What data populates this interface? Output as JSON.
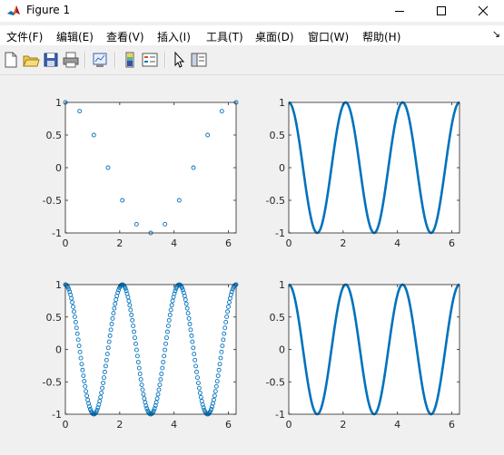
{
  "window": {
    "title": "Figure 1",
    "controls": [
      "minimize",
      "maximize",
      "close"
    ]
  },
  "menu": {
    "items": [
      "文件(F)",
      "编辑(E)",
      "查看(V)",
      "插入(I)",
      "工具(T)",
      "桌面(D)",
      "窗口(W)",
      "帮助(H)"
    ],
    "overflow_glyph": "↘"
  },
  "toolbar": {
    "buttons": [
      "new-figure-icon",
      "open-file-icon",
      "save-icon",
      "print-icon",
      "link-plot-icon",
      "insert-colorbar-icon",
      "insert-legend-icon",
      "edit-plot-arrow-icon",
      "property-inspector-icon"
    ]
  },
  "colors": {
    "series": "#0072bd",
    "axes_bg": "#ffffff",
    "figure_bg": "#f0f0f0"
  },
  "chart_data": [
    {
      "type": "scatter",
      "marker": "circle",
      "series": [
        {
          "function": "cos(x)",
          "x_start": 0,
          "x_end": 6.2832,
          "num_points": 13
        }
      ],
      "xlim": [
        0,
        6.2832
      ],
      "ylim": [
        -1,
        1
      ],
      "xticks": [
        0,
        2,
        4,
        6
      ],
      "yticks": [
        -1,
        -0.5,
        0,
        0.5,
        1
      ],
      "xtick_labels": [
        "0",
        "2",
        "4",
        "6"
      ],
      "ytick_labels": [
        "-1",
        "-0.5",
        "0",
        "0.5",
        "1"
      ],
      "grid": false
    },
    {
      "type": "line",
      "series": [
        {
          "function": "cos(3x)",
          "x_start": 0,
          "x_end": 6.2832
        }
      ],
      "xlim": [
        0,
        6.2832
      ],
      "ylim": [
        -1,
        1
      ],
      "xticks": [
        0,
        2,
        4,
        6
      ],
      "yticks": [
        -1,
        -0.5,
        0,
        0.5,
        1
      ],
      "xtick_labels": [
        "0",
        "2",
        "4",
        "6"
      ],
      "ytick_labels": [
        "-1",
        "-0.5",
        "0",
        "0.5",
        "1"
      ],
      "grid": false
    },
    {
      "type": "scatter",
      "marker": "circle",
      "series": [
        {
          "function": "cos(3x)",
          "x_start": 0,
          "x_end": 6.2832,
          "num_points": 200
        }
      ],
      "xlim": [
        0,
        6.2832
      ],
      "ylim": [
        -1,
        1
      ],
      "xticks": [
        0,
        2,
        4,
        6
      ],
      "yticks": [
        -1,
        -0.5,
        0,
        0.5,
        1
      ],
      "xtick_labels": [
        "0",
        "2",
        "4",
        "6"
      ],
      "ytick_labels": [
        "-1",
        "-0.5",
        "0",
        "0.5",
        "1"
      ],
      "grid": false
    },
    {
      "type": "line",
      "series": [
        {
          "function": "cos(3x)",
          "x_start": 0,
          "x_end": 6.2832
        }
      ],
      "xlim": [
        0,
        6.2832
      ],
      "ylim": [
        -1,
        1
      ],
      "xticks": [
        0,
        2,
        4,
        6
      ],
      "yticks": [
        -1,
        -0.5,
        0,
        0.5,
        1
      ],
      "xtick_labels": [
        "0",
        "2",
        "4",
        "6"
      ],
      "ytick_labels": [
        "-1",
        "-0.5",
        "0",
        "0.5",
        "1"
      ],
      "grid": false
    }
  ]
}
